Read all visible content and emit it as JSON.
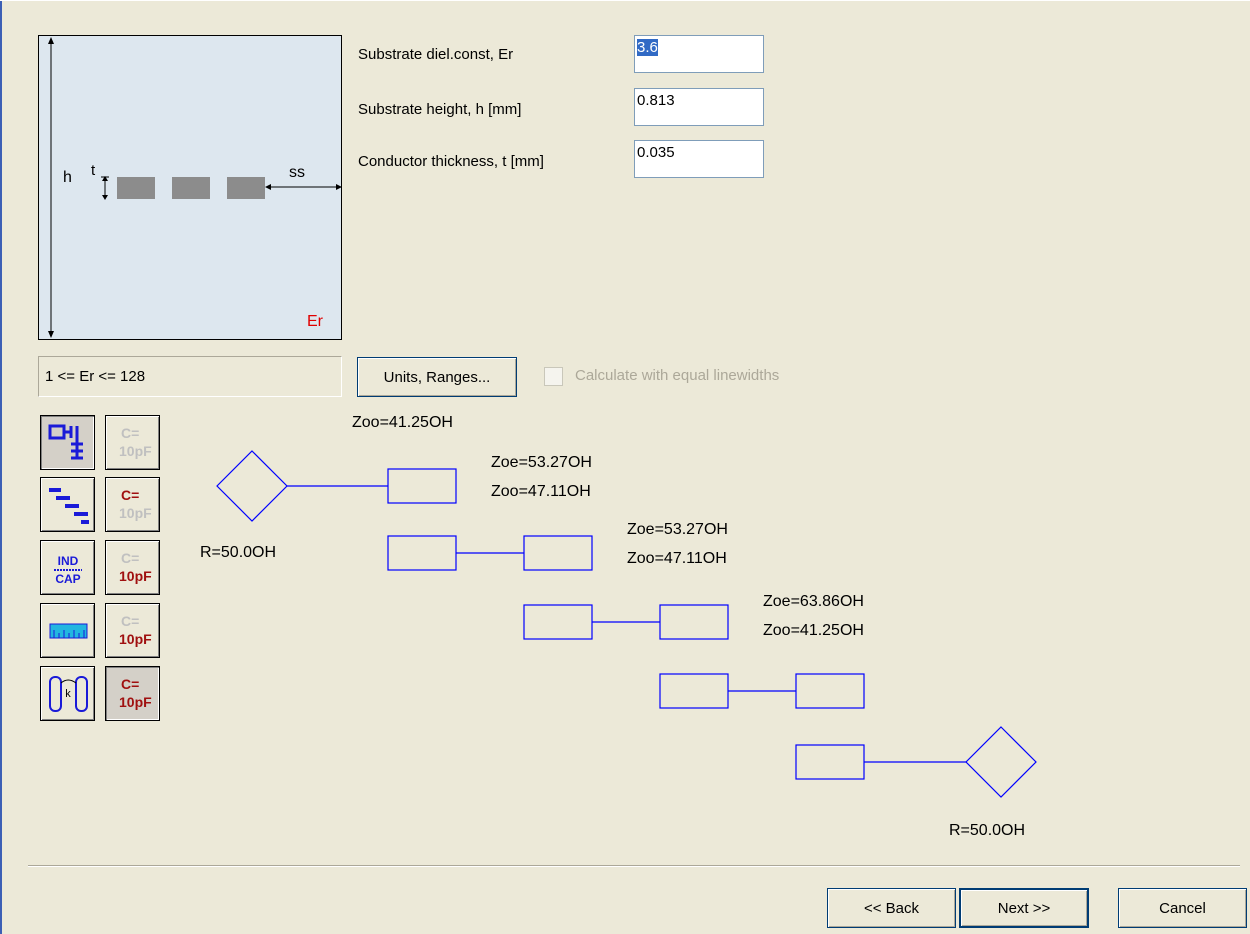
{
  "cross_section": {
    "label_h": "h",
    "label_t": "t",
    "label_ss": "ss",
    "label_er": "Er"
  },
  "params": [
    {
      "label": "Substrate diel.const, Er",
      "value": "3.6"
    },
    {
      "label": "Substrate height, h [mm]",
      "value": "0.813"
    },
    {
      "label": "Conductor thickness, t [mm]",
      "value": "0.035"
    }
  ],
  "range_text": "1 <= Er <= 128",
  "units_button": "Units, Ranges...",
  "equal_linewidths_label": "Calculate with equal linewidths",
  "equal_linewidths_checked": false,
  "tools": {
    "coupled_lines_icon": "coupled-lines-icon",
    "ind_cap_top": "IND",
    "ind_cap_bottom": "CAP",
    "capacitor_top": "C=",
    "capacitor_bottom": "10pF"
  },
  "schematic": {
    "source_r": "R=50.0OH",
    "load_r": "R=50.0OH",
    "partial_top": "Zoo=41.25OH",
    "stages": [
      {
        "zoe": "Zoe=53.27OH",
        "zoo": "Zoo=47.11OH"
      },
      {
        "zoe": "Zoe=53.27OH",
        "zoo": "Zoo=47.11OH"
      },
      {
        "zoe": "Zoe=63.86OH",
        "zoo": "Zoo=41.25OH"
      }
    ],
    "line_color": "#0000ff"
  },
  "nav": {
    "back": "<< Back",
    "next": "Next >>",
    "cancel": "Cancel"
  }
}
